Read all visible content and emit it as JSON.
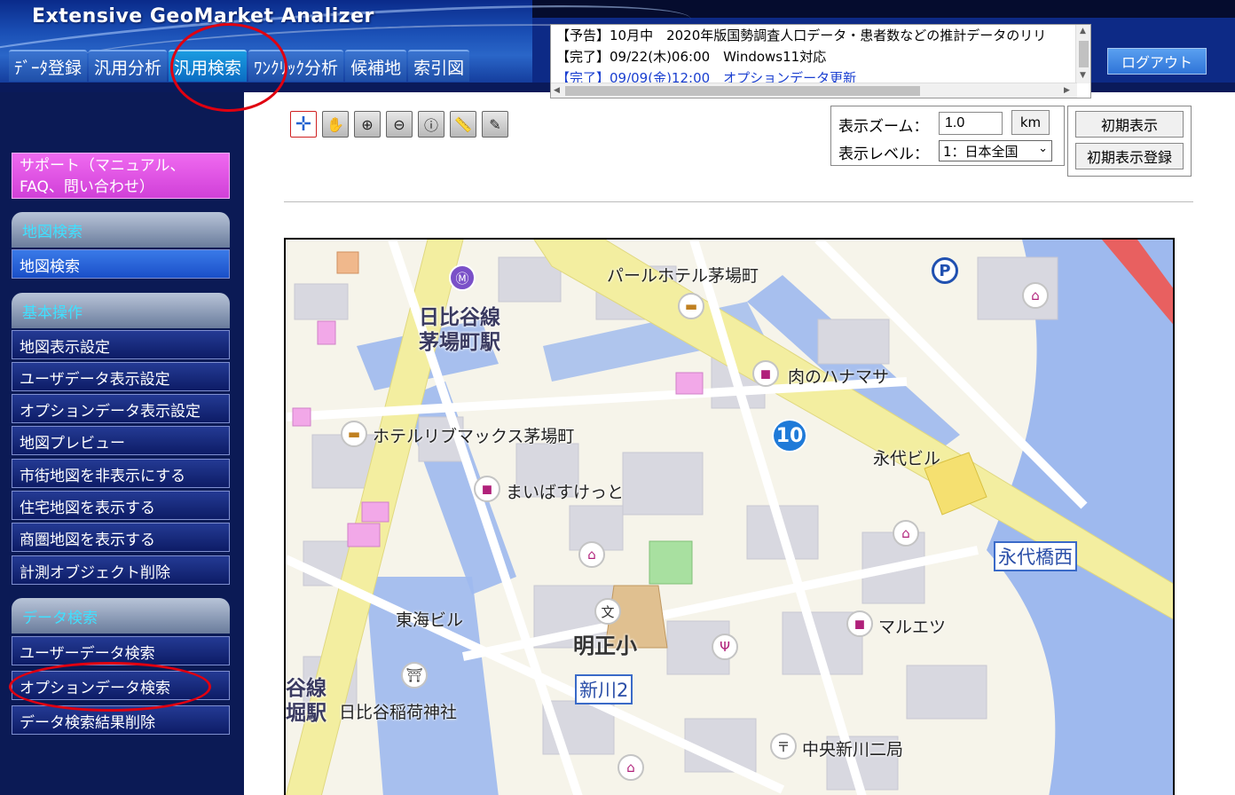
{
  "header": {
    "app_title": "Extensive GeoMarket Analizer",
    "tabs": [
      {
        "label": "ﾃﾞｰﾀ登録"
      },
      {
        "label": "汎用分析"
      },
      {
        "label": "汎用検索"
      },
      {
        "label": "ﾜﾝｸﾘｯｸ分析"
      },
      {
        "label": "候補地"
      },
      {
        "label": "索引図"
      }
    ],
    "active_tab": "汎用検索",
    "logout_label": "ログアウト"
  },
  "news": [
    {
      "text": "【予告】10月中　2020年版国勢調査人口データ・患者数などの推計データのリリ"
    },
    {
      "text": "【完了】09/22(木)06:00　Windows11対応"
    },
    {
      "text": "【完了】09/09(金)12:00　オプションデータ更新"
    }
  ],
  "sidebar": {
    "support_label": "サポート（マニュアル、FAQ、問い合わせ）",
    "sections": [
      {
        "title": "地図検索",
        "items": [
          "地図検索"
        ]
      },
      {
        "title": "基本操作",
        "items": [
          "地図表示設定",
          "ユーザデータ表示設定",
          "オプションデータ表示設定",
          "地図プレビュー",
          "市街地図を非表示にする",
          "住宅地図を表示する",
          "商圏地図を表示する",
          "計測オブジェクト削除"
        ]
      },
      {
        "title": "データ検索",
        "items": [
          "ユーザーデータ検索",
          "オプションデータ検索",
          "データ検索結果削除"
        ]
      }
    ]
  },
  "toolbar": {
    "zoom_label": "表示ズーム：",
    "zoom_value": "1.0",
    "zoom_unit": "km",
    "level_label": "表示レベル：",
    "level_value": "1：日本全国",
    "init_label": "初期表示",
    "init_register_label": "初期表示登録"
  },
  "map": {
    "labels": {
      "pearl_hotel": "パールホテル茅場町",
      "hibiya_line": "日比谷線",
      "kayabacho_station": "茅場町駅",
      "niku_no_hanamasa": "肉のハナマサ",
      "route_number": "10",
      "eitai_bldg": "永代ビル",
      "hotel_livemax": "ホテルリブマックス茅場町",
      "maibasuketto": "まいばすけっと",
      "eitaibashi_nishi": "永代橋西",
      "tokai_bldg": "東海ビル",
      "meisho_elementary": "明正小",
      "shinkawa2": "新川2",
      "maruetsu": "マルエツ",
      "hibiya_inari": "日比谷稲荷神社",
      "chuo_shinkawa_post": "中央新川二局",
      "line_fragment": "谷線",
      "station_fragment": "堀駅"
    },
    "parking_letter": "P",
    "school_glyph": "文",
    "colors": {
      "road_major": "#f3eea0",
      "water": "#9eb9ee",
      "building": "#d8d8e0",
      "commercial": "#f2a8e8"
    }
  }
}
